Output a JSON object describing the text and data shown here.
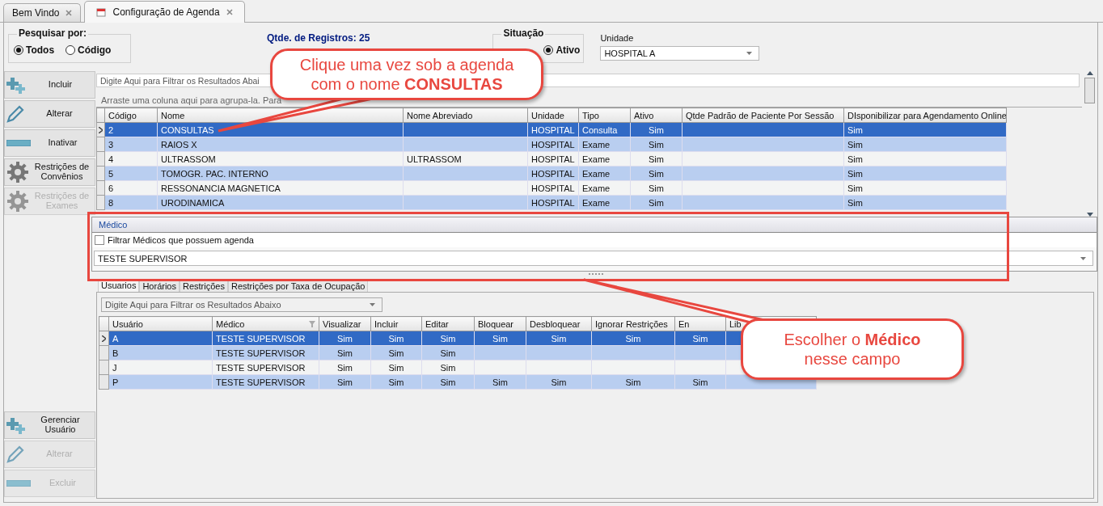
{
  "tabs": [
    {
      "label": "Bem Vindo",
      "selected": false
    },
    {
      "label": "Configuração de Agenda",
      "selected": true
    }
  ],
  "search_by": {
    "title": "Pesquisar por:",
    "options": [
      {
        "label": "Todos",
        "selected": true
      },
      {
        "label": "Código",
        "selected": false
      }
    ]
  },
  "record_count": "Qtde. de Registros:  25",
  "situacao": {
    "title": "Situação",
    "options": [
      {
        "label": "Ativo",
        "selected": true
      }
    ]
  },
  "unidade": {
    "label": "Unidade",
    "value": "HOSPITAL A"
  },
  "actions": [
    {
      "label": "Incluir",
      "kind": "plus",
      "disabled": false
    },
    {
      "label": "Alterar",
      "kind": "pencil",
      "disabled": false
    },
    {
      "label": "Inativar",
      "kind": "bar",
      "disabled": false
    },
    {
      "label": "Restrições de Convênios",
      "kind": "gear",
      "disabled": false
    },
    {
      "label": "Restrições de Exames",
      "kind": "gear",
      "disabled": true
    }
  ],
  "filter": {
    "placeholder": "Digite Aqui para Filtrar os Resultados Abai"
  },
  "group_hint": "Arraste uma coluna aqui para agrupa-la. Para",
  "agenda_table": {
    "columns": [
      "Código",
      "Nome",
      "Nome Abreviado",
      "Unidade",
      "Tipo",
      "Ativo",
      "Qtde Padrão de Paciente Por Sessão",
      "DIsponibilizar para Agendamento Online"
    ],
    "rows": [
      {
        "selected": true,
        "cells": [
          "2",
          "CONSULTAS",
          "",
          "HOSPITAL",
          "Consulta",
          "Sim",
          "",
          "Sim"
        ]
      },
      {
        "selected": false,
        "cells": [
          "3",
          "RAIOS X",
          "",
          "HOSPITAL",
          "Exame",
          "Sim",
          "",
          "Sim"
        ]
      },
      {
        "selected": false,
        "cells": [
          "4",
          "ULTRASSOM",
          "ULTRASSOM",
          "HOSPITAL",
          "Exame",
          "Sim",
          "",
          "Sim"
        ]
      },
      {
        "selected": false,
        "cells": [
          "5",
          "TOMOGR. PAC. INTERNO",
          "",
          "HOSPITAL",
          "Exame",
          "Sim",
          "",
          "Sim"
        ]
      },
      {
        "selected": false,
        "cells": [
          "6",
          "RESSONANCIA MAGNETICA",
          "",
          "HOSPITAL",
          "Exame",
          "Sim",
          "",
          "Sim"
        ]
      },
      {
        "selected": false,
        "cells": [
          "8",
          "URODINAMICA",
          "",
          "HOSPITAL",
          "Exame",
          "Sim",
          "",
          "Sim"
        ]
      }
    ]
  },
  "medico": {
    "title": "Médico",
    "checkbox": {
      "label": "Filtrar Médicos que possuem agenda",
      "checked": false
    },
    "value": "TESTE SUPERVISOR"
  },
  "detail_tabs": [
    {
      "label": "Usuarios",
      "selected": true
    },
    {
      "label": "Horários",
      "selected": false
    },
    {
      "label": "Restrições",
      "selected": false
    },
    {
      "label": "Restrições por Taxa de Ocupação",
      "selected": false
    }
  ],
  "detail_filter": {
    "placeholder": "Digite Aqui para Filtrar os Resultados Abaixo"
  },
  "users_table": {
    "columns": [
      "Usuário",
      "Médico",
      "Visualizar",
      "Incluir",
      "Editar",
      "Bloquear",
      "Desbloquear",
      "Ignorar Restrições",
      "En",
      "Lib"
    ],
    "rows": [
      {
        "selected": true,
        "cells": [
          "A",
          "TESTE SUPERVISOR",
          "Sim",
          "Sim",
          "Sim",
          "Sim",
          "Sim",
          "Sim",
          "Sim",
          ""
        ]
      },
      {
        "selected": false,
        "cells": [
          "B",
          "TESTE SUPERVISOR",
          "Sim",
          "Sim",
          "Sim",
          "",
          "",
          "",
          "",
          ""
        ]
      },
      {
        "selected": false,
        "cells": [
          "J",
          "TESTE SUPERVISOR",
          "Sim",
          "Sim",
          "Sim",
          "",
          "",
          "",
          "",
          ""
        ]
      },
      {
        "selected": false,
        "cells": [
          "P",
          "TESTE SUPERVISOR",
          "Sim",
          "Sim",
          "Sim",
          "Sim",
          "Sim",
          "Sim",
          "Sim",
          ""
        ]
      }
    ]
  },
  "user_actions": [
    {
      "label": "Gerenciar Usuário",
      "kind": "plus",
      "disabled": false
    },
    {
      "label": "Alterar",
      "kind": "pencil",
      "disabled": true
    },
    {
      "label": "Excluir",
      "kind": "bar",
      "disabled": true
    }
  ],
  "callouts": [
    {
      "text": "Clique uma vez sob a agenda com o nome **CONSULTAS**"
    },
    {
      "text": "Escolher o **Médico** nesse campo"
    }
  ]
}
